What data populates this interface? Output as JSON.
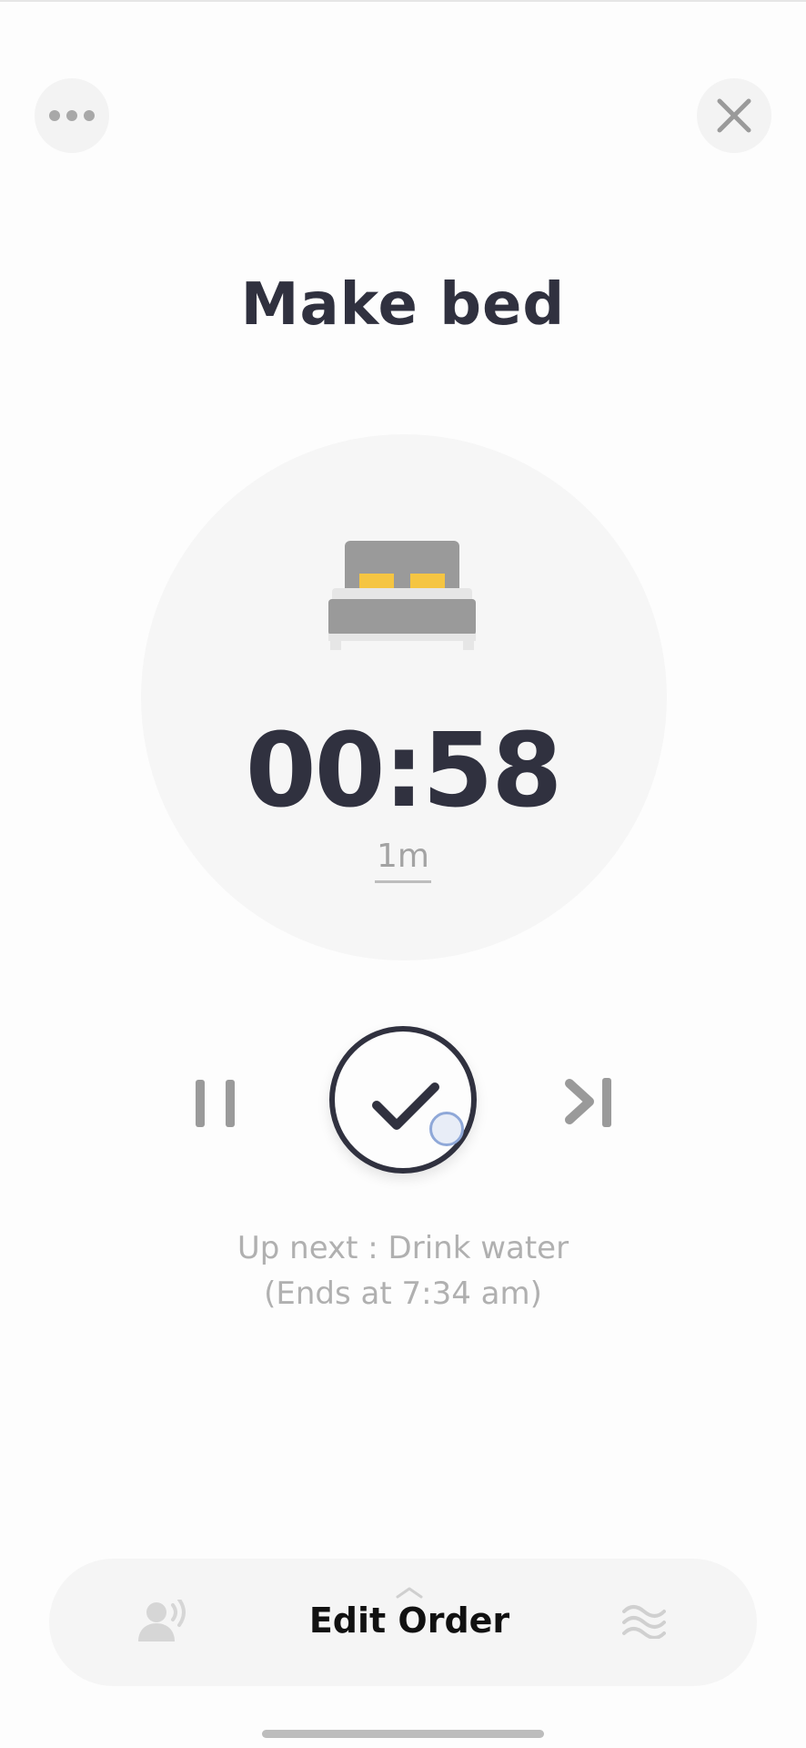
{
  "task": {
    "title": "Make bed",
    "icon": "bed-icon"
  },
  "timer": {
    "value": "00:58",
    "duration": "1m"
  },
  "header": {
    "more_icon": "more-horizontal-icon",
    "close_icon": "close-icon"
  },
  "controls": {
    "pause_icon": "pause-icon",
    "complete_icon": "checkmark-icon",
    "skip_icon": "skip-next-icon"
  },
  "up_next": {
    "line1": "Up next : Drink water",
    "line2": "(Ends at 7:34 am)"
  },
  "bottom_bar": {
    "edit_order_label": "Edit Order",
    "left_icon": "voice-person-icon",
    "right_icon": "wave-icon",
    "chevron_icon": "chevron-up-icon"
  },
  "colors": {
    "primary_text": "#30313f",
    "muted_text": "#b0b0b0",
    "bed_pillow": "#f5c542",
    "bed_frame": "#9a9a9a"
  }
}
